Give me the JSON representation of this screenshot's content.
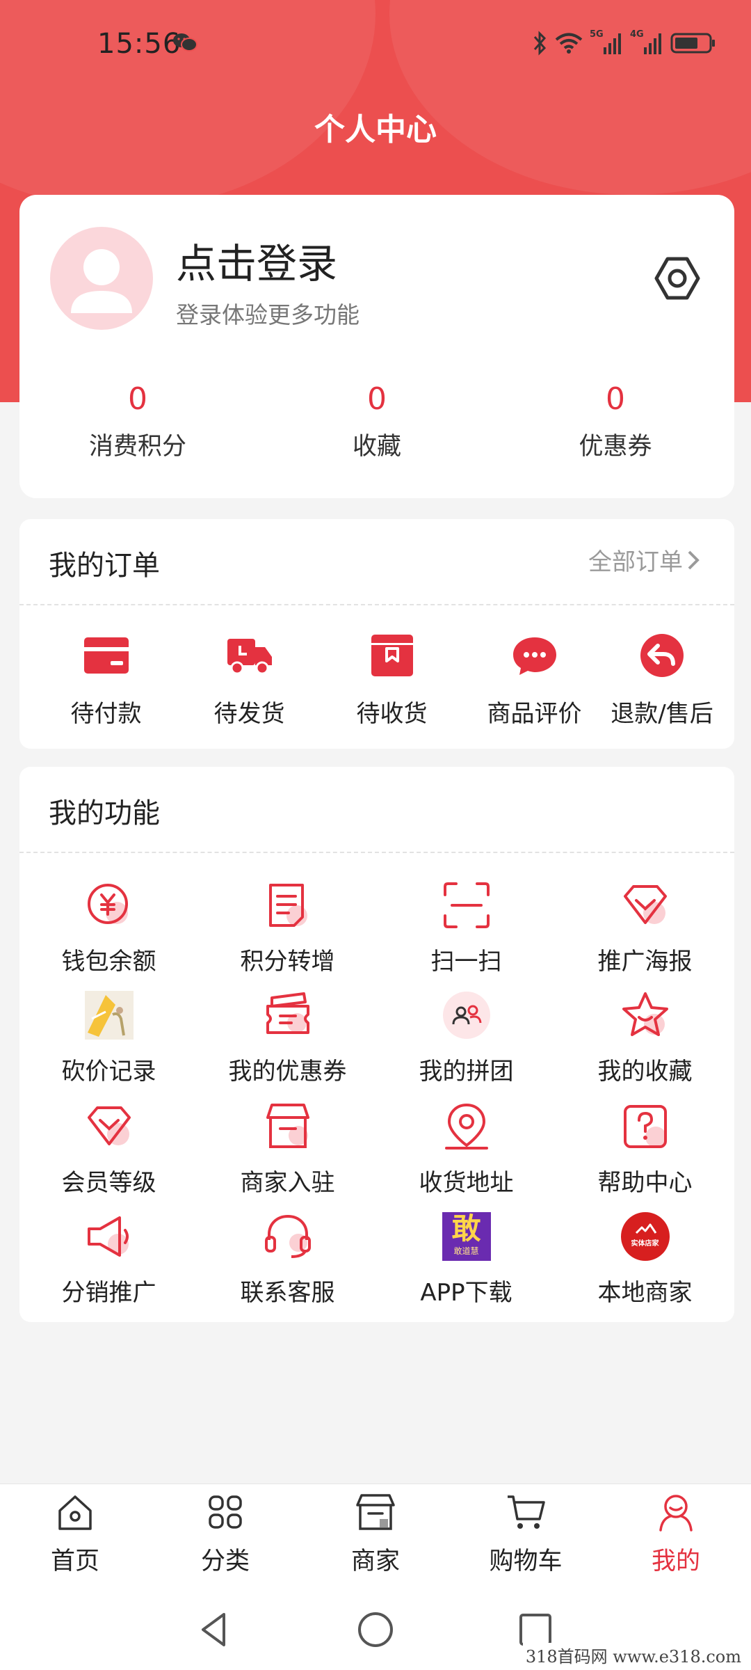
{
  "status_bar": {
    "time": "15:56",
    "network_a": "5G",
    "network_b": "4G"
  },
  "header": {
    "title": "个人中心"
  },
  "profile": {
    "title": "点击登录",
    "subtitle": "登录体验更多功能",
    "stats": [
      {
        "value": "0",
        "label": "消费积分"
      },
      {
        "value": "0",
        "label": "收藏"
      },
      {
        "value": "0",
        "label": "优惠券"
      }
    ]
  },
  "orders": {
    "title": "我的订单",
    "see_all": "全部订单",
    "items": [
      {
        "label": "待付款",
        "icon": "card-icon"
      },
      {
        "label": "待发货",
        "icon": "truck-icon"
      },
      {
        "label": "待收货",
        "icon": "package-icon"
      },
      {
        "label": "商品评价",
        "icon": "comment-icon"
      },
      {
        "label": "退款/售后",
        "icon": "return-icon"
      }
    ]
  },
  "functions": {
    "title": "我的功能",
    "items": [
      {
        "label": "钱包余额",
        "icon": "wallet-yen-icon"
      },
      {
        "label": "积分转增",
        "icon": "document-icon"
      },
      {
        "label": "扫一扫",
        "icon": "scan-icon"
      },
      {
        "label": "推广海报",
        "icon": "diamond-icon"
      },
      {
        "label": "砍价记录",
        "icon": "bargain-image-icon"
      },
      {
        "label": "我的优惠券",
        "icon": "coupon-icon"
      },
      {
        "label": "我的拼团",
        "icon": "group-icon"
      },
      {
        "label": "我的收藏",
        "icon": "star-icon"
      },
      {
        "label": "会员等级",
        "icon": "member-level-icon"
      },
      {
        "label": "商家入驻",
        "icon": "store-icon"
      },
      {
        "label": "收货地址",
        "icon": "location-pin-icon"
      },
      {
        "label": "帮助中心",
        "icon": "help-icon"
      },
      {
        "label": "分销推广",
        "icon": "megaphone-icon"
      },
      {
        "label": "联系客服",
        "icon": "headset-icon"
      },
      {
        "label": "APP下载",
        "icon": "app-logo-icon"
      },
      {
        "label": "本地商家",
        "icon": "local-store-logo-icon"
      }
    ],
    "app_logo_text": "敢",
    "app_logo_sub": "敢道慧",
    "local_logo_text": "实体店家"
  },
  "tabbar": {
    "items": [
      {
        "label": "首页",
        "icon": "home-icon"
      },
      {
        "label": "分类",
        "icon": "category-icon"
      },
      {
        "label": "商家",
        "icon": "shop-icon"
      },
      {
        "label": "购物车",
        "icon": "cart-icon"
      },
      {
        "label": "我的",
        "icon": "profile-icon"
      }
    ],
    "active": "我的"
  },
  "watermark": "318首码网 www.e318.com",
  "colors": {
    "accent": "#e43240",
    "header_bg": "#ec4f4f",
    "page_bg": "#f4f4f4"
  }
}
